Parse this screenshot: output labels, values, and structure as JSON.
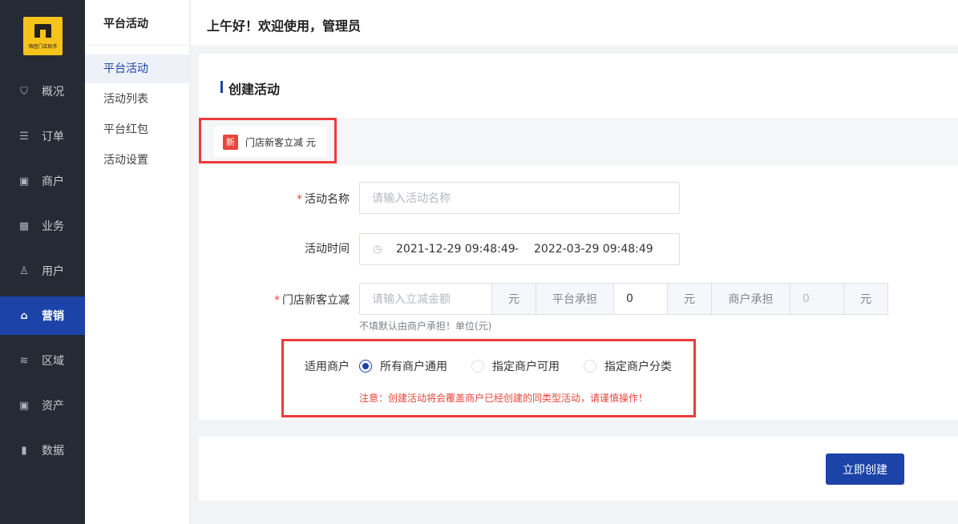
{
  "app": {
    "logo_text": "嗨团门店助手"
  },
  "nav": {
    "items": [
      {
        "label": "概况",
        "icon": "dashboard-icon",
        "glyph": "⛉"
      },
      {
        "label": "订单",
        "icon": "order-icon",
        "glyph": "☰"
      },
      {
        "label": "商户",
        "icon": "merchant-icon",
        "glyph": "▣"
      },
      {
        "label": "业务",
        "icon": "business-icon",
        "glyph": "▦"
      },
      {
        "label": "用户",
        "icon": "user-icon",
        "glyph": "♙"
      },
      {
        "label": "营销",
        "icon": "marketing-icon",
        "glyph": "⌂",
        "active": true
      },
      {
        "label": "区域",
        "icon": "region-icon",
        "glyph": "≋"
      },
      {
        "label": "资产",
        "icon": "assets-icon",
        "glyph": "▣"
      },
      {
        "label": "数据",
        "icon": "data-chart-icon",
        "glyph": "▮"
      }
    ]
  },
  "subnav": {
    "title": "平台活动",
    "items": [
      {
        "label": "平台活动",
        "active": true
      },
      {
        "label": "活动列表"
      },
      {
        "label": "平台红包"
      },
      {
        "label": "活动设置"
      }
    ]
  },
  "header": {
    "greeting": "上午好！欢迎使用，管理员"
  },
  "form": {
    "title": "创建活动",
    "tab": {
      "badge": "新",
      "label": "门店新客立减 元"
    },
    "name": {
      "label": "活动名称",
      "placeholder": "请输入活动名称"
    },
    "time": {
      "label": "活动时间",
      "start": "2021-12-29 09:48:49",
      "separator": "-",
      "end": "2022-03-29 09:48:49"
    },
    "discount": {
      "label": "门店新客立减",
      "placeholder": "请输入立减金额",
      "unit": "元",
      "platform_label": "平台承担",
      "platform_value": "0",
      "platform_unit": "元",
      "merchant_label": "商户承担",
      "merchant_value": "0",
      "merchant_unit": "元",
      "hint": "不填默认由商户承担！单位(元)"
    },
    "scope": {
      "label": "适用商户",
      "options": [
        "所有商户通用",
        "指定商户可用",
        "指定商户分类"
      ],
      "selected": "所有商户通用",
      "warning": "注意：创建活动将会覆盖商户已经创建的同类型活动，请谨慎操作！"
    },
    "submit_label": "立即创建"
  },
  "colors": {
    "accent": "#1b43a8",
    "sidebar": "#252a34",
    "highlight": "#ee3a3a",
    "danger": "#e9453b",
    "logo": "#f6c31b"
  }
}
